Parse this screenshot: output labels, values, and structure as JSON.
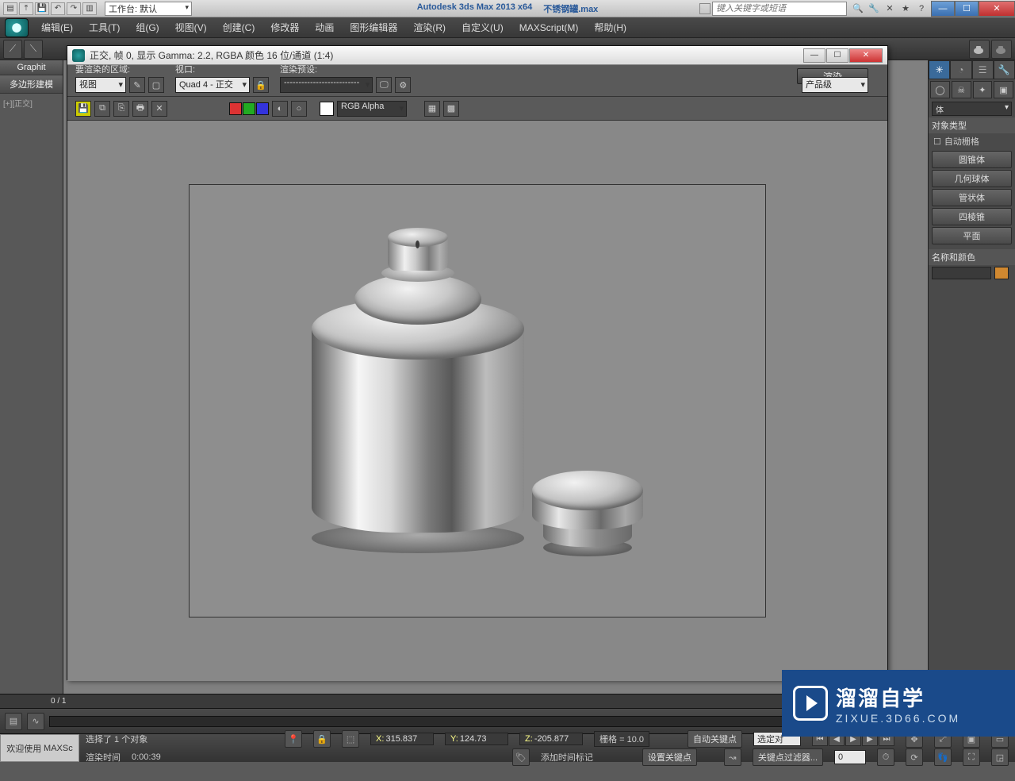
{
  "title_bar": {
    "workspace_label": "工作台: 默认",
    "app_name": "Autodesk 3ds Max  2013 x64",
    "file_name": "不锈钢罐.max",
    "search_placeholder": "键入关键字或短语"
  },
  "menu": [
    "编辑(E)",
    "工具(T)",
    "组(G)",
    "视图(V)",
    "创建(C)",
    "修改器",
    "动画",
    "图形编辑器",
    "渲染(R)",
    "自定义(U)",
    "MAXScript(M)",
    "帮助(H)"
  ],
  "left_ribbon": {
    "tab1": "Graphit",
    "tab2": "多边形建模",
    "vp_label": "[+][正交]"
  },
  "render_frame": {
    "title": "正交, 帧 0, 显示 Gamma: 2.2, RGBA 颜色 16 位/通道 (1:4)",
    "area_label": "要渲染的区域:",
    "area_value": "视图",
    "viewport_label": "视口:",
    "viewport_value": "Quad 4 - 正交",
    "preset_label": "渲染预设:",
    "preset_value": "--------------------------",
    "render_btn": "渲染",
    "production": "产品级",
    "channel": "RGB Alpha"
  },
  "cmd_panel": {
    "section_objtype": "对象类型",
    "auto_grid": "自动栅格",
    "buttons": [
      "圆锥体",
      "几何球体",
      "管状体",
      "四棱锥",
      "平面"
    ],
    "section_name": "名称和颜色"
  },
  "timeline": {
    "frame": "0 / 1"
  },
  "status": {
    "welcome": "欢迎使用",
    "script": "MAXSc",
    "sel_msg": "选择了 1 个对象",
    "render_time_lbl": "渲染时间",
    "render_time": "0:00:39",
    "x": "315.837",
    "y": "124.73",
    "z": "-205.877",
    "grid": "栅格 = 10.0",
    "auto_key": "自动关键点",
    "sel_mode": "选定对",
    "set_key": "设置关键点",
    "key_filter": "关键点过滤器...",
    "add_marker": "添加时间标记"
  },
  "watermark": {
    "zh": "溜溜自学",
    "en": "ZIXUE.3D66.COM"
  }
}
